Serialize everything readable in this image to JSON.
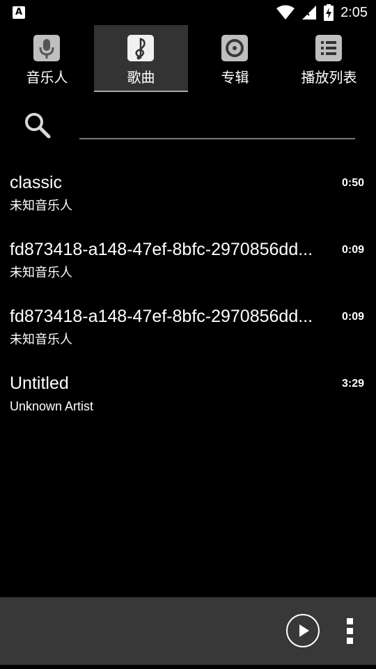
{
  "status_bar": {
    "app_badge": "A",
    "time": "2:05"
  },
  "tabs": [
    {
      "label": "音乐人",
      "icon": "microphone-icon",
      "selected": false
    },
    {
      "label": "歌曲",
      "icon": "music-note-icon",
      "selected": true
    },
    {
      "label": "专辑",
      "icon": "album-disc-icon",
      "selected": false
    },
    {
      "label": "播放列表",
      "icon": "playlist-icon",
      "selected": false
    }
  ],
  "search": {
    "value": "",
    "placeholder": ""
  },
  "songs": [
    {
      "title": "classic",
      "artist": "未知音乐人",
      "duration": "0:50"
    },
    {
      "title": "fd873418-a148-47ef-8bfc-2970856dd...",
      "artist": "未知音乐人",
      "duration": "0:09"
    },
    {
      "title": "fd873418-a148-47ef-8bfc-2970856dd...",
      "artist": "未知音乐人",
      "duration": "0:09"
    },
    {
      "title": "Untitled",
      "artist": "Unknown Artist",
      "duration": "3:29"
    }
  ],
  "colors": {
    "background": "#000000",
    "tab_selected": "#333333",
    "bottom_bar": "#383838",
    "search_underline": "#7a7a7a"
  }
}
